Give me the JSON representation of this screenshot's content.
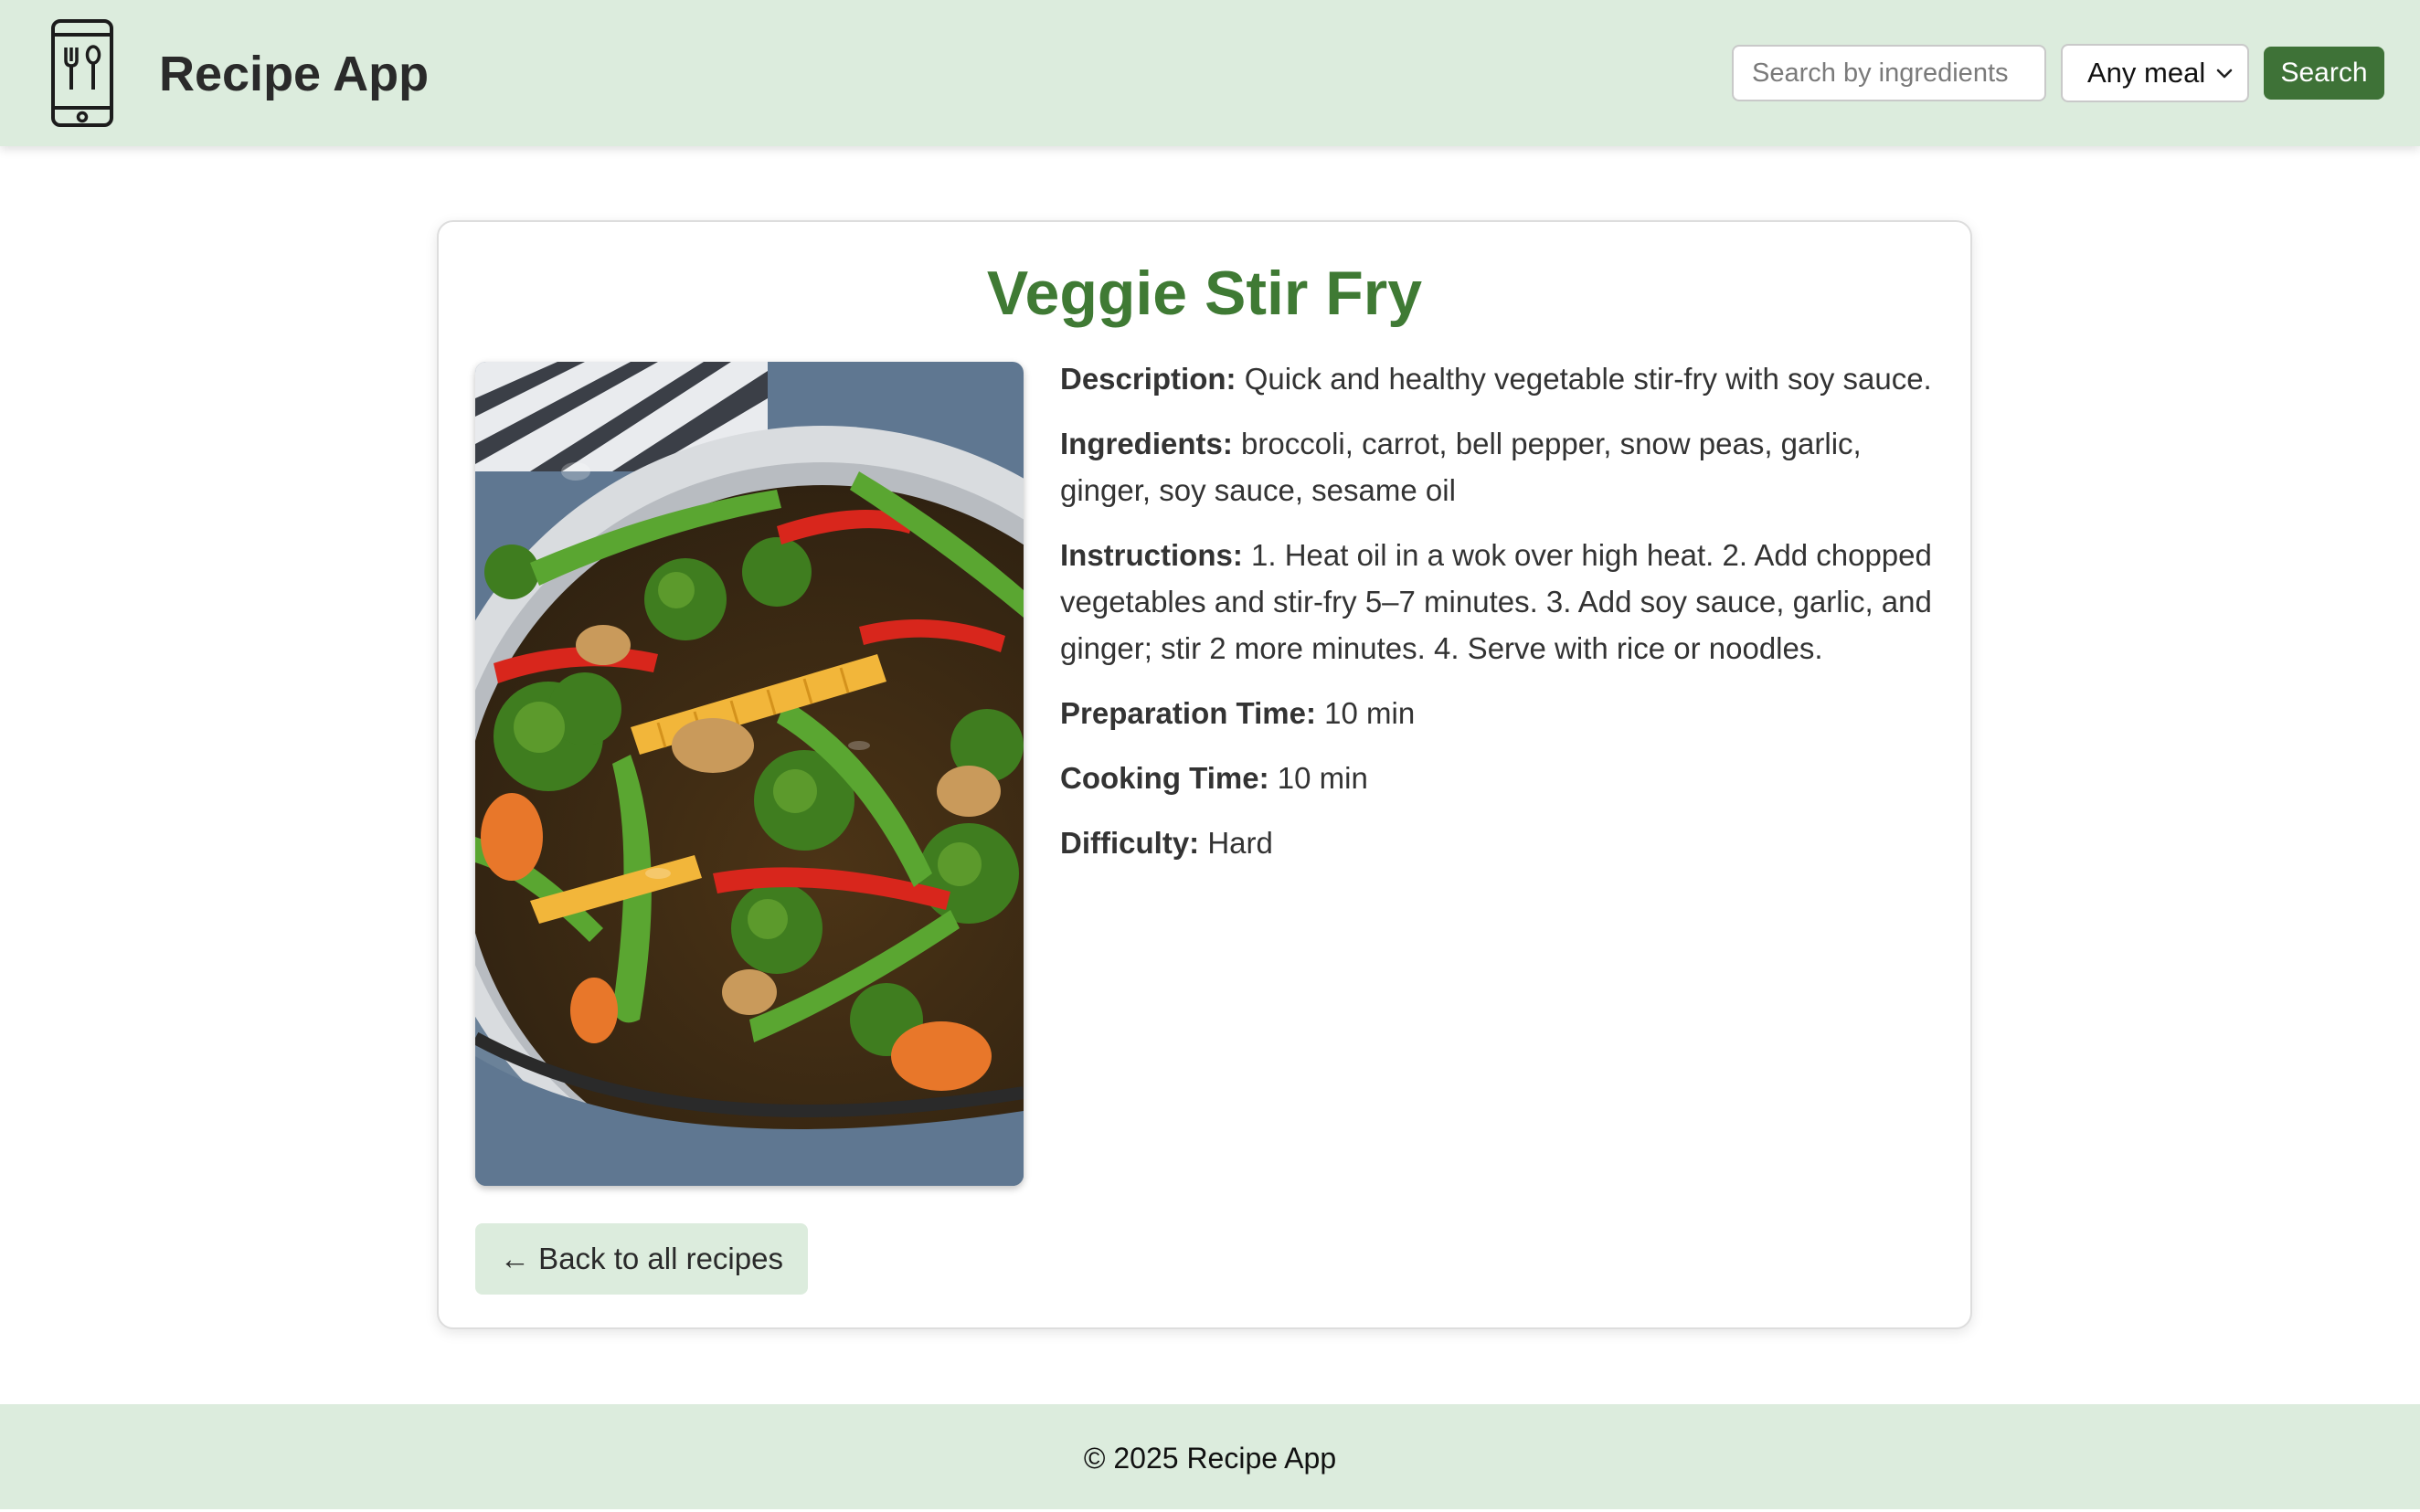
{
  "header": {
    "app_title": "Recipe App",
    "logo_icon": "phone-utensils-icon",
    "search": {
      "placeholder": "Search by ingredients",
      "value": ""
    },
    "meal_filter": {
      "selected": "Any meal"
    },
    "search_button_label": "Search"
  },
  "recipe": {
    "title": "Veggie Stir Fry",
    "description_label": "Description:",
    "description": "Quick and healthy vegetable stir-fry with soy sauce.",
    "ingredients_label": "Ingredients:",
    "ingredients": "broccoli, carrot, bell pepper, snow peas, garlic, ginger, soy sauce, sesame oil",
    "instructions_label": "Instructions:",
    "instructions": "1. Heat oil in a wok over high heat. 2. Add chopped vegetables and stir-fry 5–7 minutes. 3. Add soy sauce, garlic, and ginger; stir 2 more minutes. 4. Serve with rice or noodles.",
    "prep_time_label": "Preparation Time:",
    "prep_time": "10 min",
    "cook_time_label": "Cooking Time:",
    "cook_time": "10 min",
    "difficulty_label": "Difficulty:",
    "difficulty": "Hard",
    "back_button_label": "← Back to all recipes"
  },
  "footer": {
    "text": "© 2025 Recipe App"
  },
  "colors": {
    "header_bg": "#dcecdd",
    "accent_green": "#3e7237",
    "title_green": "#3f7a34"
  }
}
